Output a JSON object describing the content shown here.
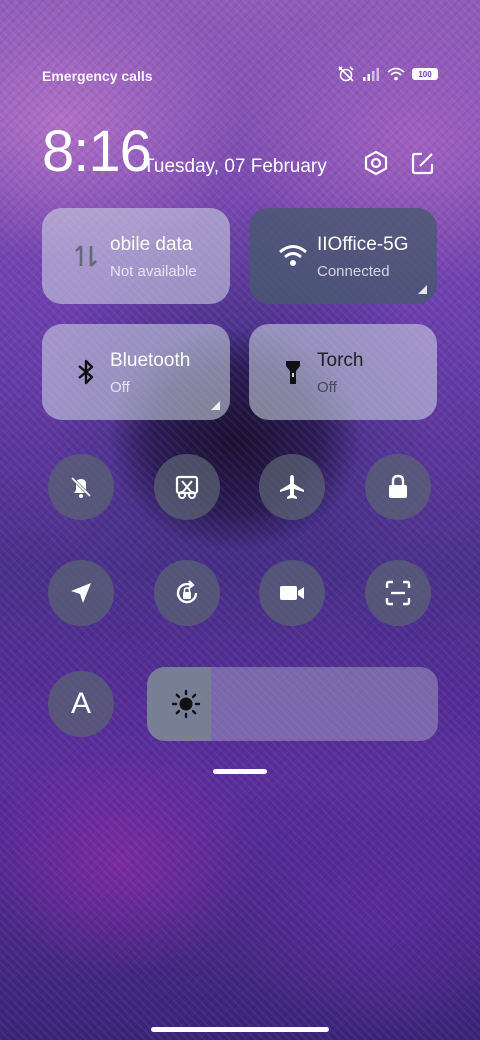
{
  "status_bar": {
    "carrier_text": "Emergency calls",
    "battery_level": "100"
  },
  "header": {
    "time": "8:16",
    "date": "Tuesday, 07 February"
  },
  "tiles": [
    {
      "title": "obile data",
      "subtitle": "Not available",
      "icon": "mobile-data-icon",
      "active": false
    },
    {
      "title": "IIOffice-5G",
      "subtitle": "Connected",
      "icon": "wifi-icon",
      "active": true
    },
    {
      "title": "Bluetooth",
      "subtitle": "Off",
      "icon": "bluetooth-icon",
      "active": false
    },
    {
      "title": "Torch",
      "subtitle": "Off",
      "icon": "torch-icon",
      "active": false
    }
  ],
  "toggles_row1": [
    "mute-icon",
    "screenshot-icon",
    "airplane-mode-icon",
    "lock-screen-icon"
  ],
  "toggles_row2": [
    "location-icon",
    "rotation-lock-icon",
    "screen-recorder-icon",
    "scanner-icon"
  ],
  "brightness": {
    "level_fraction": 0.22
  },
  "font_button_label": "A",
  "colors": {
    "active_tile": "#465a6e",
    "inactive_tile": "#d2dce6",
    "round_button": "#5a6473"
  }
}
